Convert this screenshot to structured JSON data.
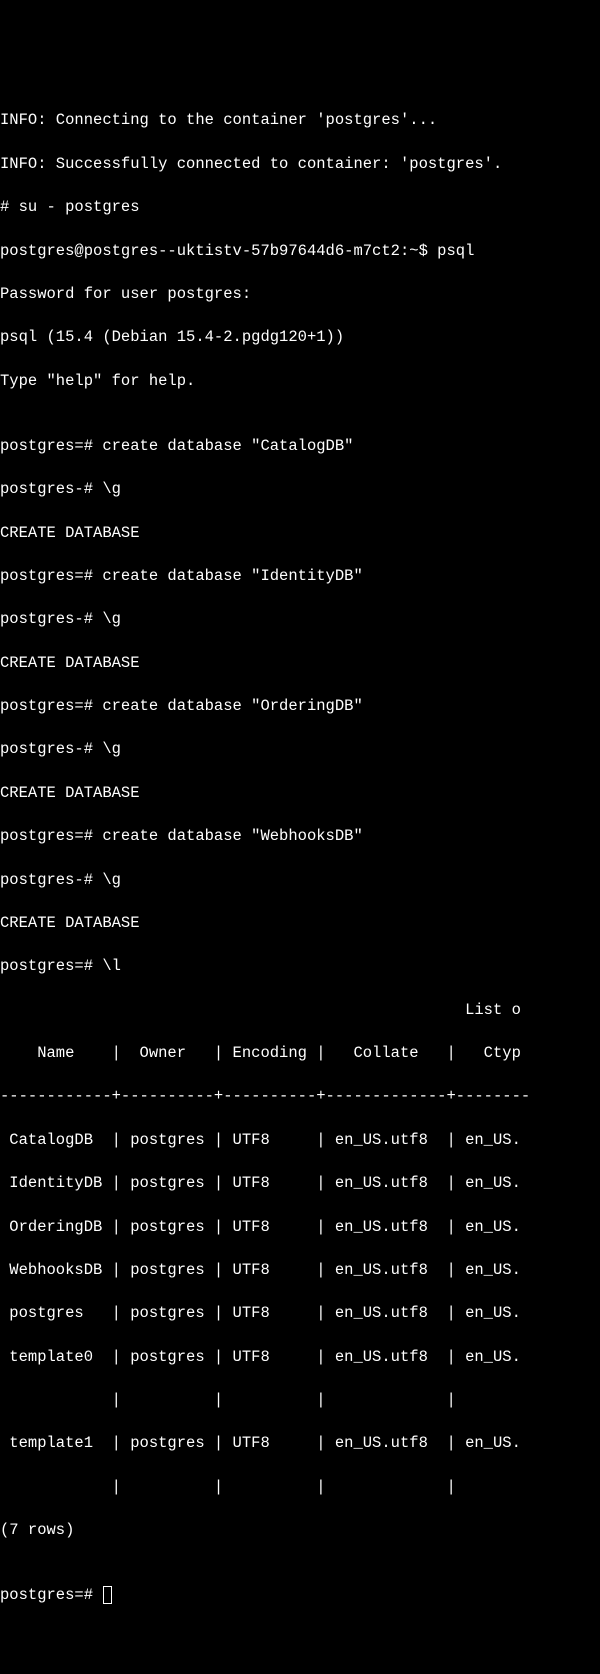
{
  "lines": {
    "l0": "INFO: Connecting to the container 'postgres'...",
    "l1": "INFO: Successfully connected to container: 'postgres'.",
    "l2": "# su - postgres",
    "l3": "postgres@postgres--uktistv-57b97644d6-m7ct2:~$ psql",
    "l4": "Password for user postgres:",
    "l5": "psql (15.4 (Debian 15.4-2.pgdg120+1))",
    "l6": "Type \"help\" for help.",
    "l7": "",
    "l8": "postgres=# create database \"CatalogDB\"",
    "l9": "postgres-# \\g",
    "l10": "CREATE DATABASE",
    "l11": "postgres=# create database \"IdentityDB\"",
    "l12": "postgres-# \\g",
    "l13": "CREATE DATABASE",
    "l14": "postgres=# create database \"OrderingDB\"",
    "l15": "postgres-# \\g",
    "l16": "CREATE DATABASE",
    "l17": "postgres=# create database \"WebhooksDB\"",
    "l18": "postgres-# \\g",
    "l19": "CREATE DATABASE",
    "l20": "postgres=# \\l",
    "l21": "                                                  List o",
    "l22": "    Name    |  Owner   | Encoding |   Collate   |   Ctyp",
    "l23": "------------+----------+----------+-------------+--------",
    "l24": " CatalogDB  | postgres | UTF8     | en_US.utf8  | en_US.",
    "l25": " IdentityDB | postgres | UTF8     | en_US.utf8  | en_US.",
    "l26": " OrderingDB | postgres | UTF8     | en_US.utf8  | en_US.",
    "l27": " WebhooksDB | postgres | UTF8     | en_US.utf8  | en_US.",
    "l28": " postgres   | postgres | UTF8     | en_US.utf8  | en_US.",
    "l29": " template0  | postgres | UTF8     | en_US.utf8  | en_US.",
    "l30": "            |          |          |             |",
    "l31": " template1  | postgres | UTF8     | en_US.utf8  | en_US.",
    "l32": "            |          |          |             |",
    "l33": "(7 rows)",
    "l34": "",
    "l35": "postgres=# "
  },
  "chart_data": {
    "type": "table",
    "title": "List of databases",
    "columns": [
      "Name",
      "Owner",
      "Encoding",
      "Collate",
      "Ctype"
    ],
    "rows": [
      {
        "Name": "CatalogDB",
        "Owner": "postgres",
        "Encoding": "UTF8",
        "Collate": "en_US.utf8",
        "Ctype": "en_US."
      },
      {
        "Name": "IdentityDB",
        "Owner": "postgres",
        "Encoding": "UTF8",
        "Collate": "en_US.utf8",
        "Ctype": "en_US."
      },
      {
        "Name": "OrderingDB",
        "Owner": "postgres",
        "Encoding": "UTF8",
        "Collate": "en_US.utf8",
        "Ctype": "en_US."
      },
      {
        "Name": "WebhooksDB",
        "Owner": "postgres",
        "Encoding": "UTF8",
        "Collate": "en_US.utf8",
        "Ctype": "en_US."
      },
      {
        "Name": "postgres",
        "Owner": "postgres",
        "Encoding": "UTF8",
        "Collate": "en_US.utf8",
        "Ctype": "en_US."
      },
      {
        "Name": "template0",
        "Owner": "postgres",
        "Encoding": "UTF8",
        "Collate": "en_US.utf8",
        "Ctype": "en_US."
      },
      {
        "Name": "template1",
        "Owner": "postgres",
        "Encoding": "UTF8",
        "Collate": "en_US.utf8",
        "Ctype": "en_US."
      }
    ],
    "row_count_text": "(7 rows)"
  },
  "psql": {
    "version": "15.4",
    "distro": "Debian 15.4-2.pgdg120+1",
    "user": "postgres",
    "host": "postgres--uktistv-57b97644d6-m7ct2",
    "container": "postgres"
  }
}
